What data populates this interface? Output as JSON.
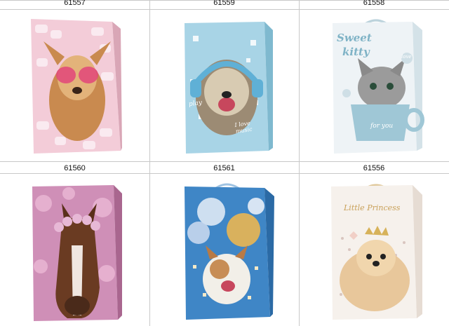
{
  "products": [
    {
      "code": "61557",
      "theme": "dog with heart sunglasses on marshmallows",
      "colors": {
        "main": "#f2c9d6",
        "accent": "#e2457a"
      }
    },
    {
      "code": "61559",
      "theme": "terrier with headphones",
      "colors": {
        "main": "#a9d6e8",
        "accent": "#2f9fc6"
      },
      "text": {
        "a": "play",
        "b": "I love music"
      }
    },
    {
      "code": "61558",
      "theme": "kitten in cup",
      "colors": {
        "main": "#eef3f6",
        "accent": "#8fbccb"
      },
      "text": {
        "a": "Sweet",
        "b": "kitty",
        "c": "for you",
        "d": "love"
      }
    },
    {
      "code": "61560",
      "theme": "horse with flower crown",
      "colors": {
        "main": "#d38db5",
        "accent": "#5b3322"
      }
    },
    {
      "code": "61561",
      "theme": "terrier with balloons",
      "colors": {
        "main": "#3d86c6",
        "accent": "#d8b05a"
      }
    },
    {
      "code": "61556",
      "theme": "pomeranian with crown",
      "colors": {
        "main": "#f6f0ea",
        "accent": "#d7b25a"
      },
      "text": {
        "a": "Little Princess"
      }
    }
  ]
}
